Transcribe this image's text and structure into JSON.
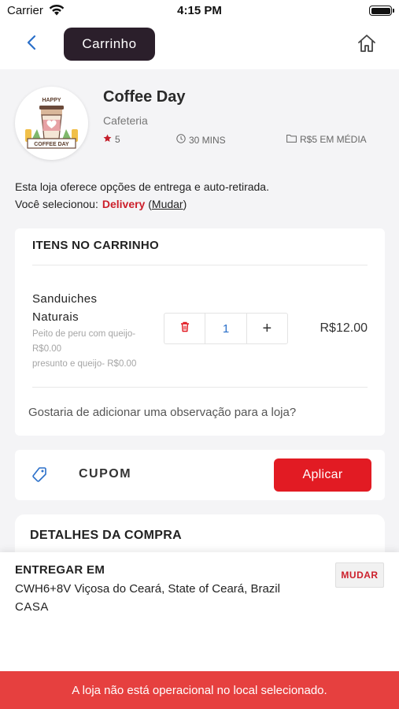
{
  "status_bar": {
    "carrier": "Carrier",
    "time": "4:15 PM"
  },
  "nav": {
    "title": "Carrinho"
  },
  "store": {
    "name": "Coffee Day",
    "category": "Cafeteria",
    "rating": "5",
    "delivery_time": "30 MINS",
    "avg_price": "R$5 EM MÉDIA",
    "logo_text_top": "HAPPY",
    "logo_text_bottom": "COFFEE DAY"
  },
  "delivery_info": {
    "line1": "Esta loja oferece opções de entrega e auto-retirada.",
    "selected_prefix": "Você selecionou:",
    "mode": "Delivery",
    "paren_open": "(",
    "change": "Mudar",
    "paren_close": ")"
  },
  "cart": {
    "header": "ITENS NO CARRINHO",
    "items": [
      {
        "name_line1": "Sanduiches",
        "name_line2": "Naturais",
        "options": [
          "Peito de peru com queijo-",
          "R$0.00",
          "presunto e queijo- R$0.00"
        ],
        "quantity": "1",
        "plus": "+",
        "price": "R$12.00"
      }
    ],
    "note_prompt": "Gostaria de adicionar uma observação para a loja?"
  },
  "coupon": {
    "label": "CUPOM",
    "apply": "Aplicar"
  },
  "details": {
    "label": "DETALHES DA COMPRA"
  },
  "deliver_to": {
    "title": "ENTREGAR EM",
    "address": "CWH6+8V Viçosa do Ceará, State of Ceará, Brazil",
    "tag": "CASA",
    "change": "MUDAR"
  },
  "error": {
    "message": "A loja não está operacional no local selecionado."
  },
  "colors": {
    "accent": "#e21b23",
    "pill": "#2b1f2b",
    "error_bar": "#e6403f",
    "qty": "#2a6fc9"
  }
}
